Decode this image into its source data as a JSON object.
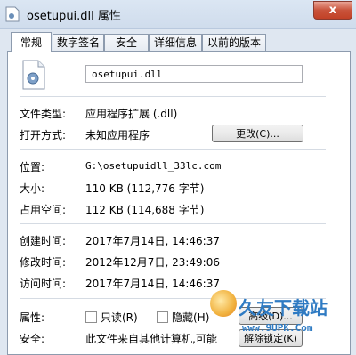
{
  "window": {
    "title": "osetupui.dll 属性",
    "close_symbol": "x"
  },
  "tabs": [
    {
      "label": "常规",
      "active": true
    },
    {
      "label": "数字签名",
      "active": false
    },
    {
      "label": "安全",
      "active": false
    },
    {
      "label": "详细信息",
      "active": false
    },
    {
      "label": "以前的版本",
      "active": false
    }
  ],
  "general": {
    "file_name": "osetupui.dll",
    "rows": {
      "type": {
        "label": "文件类型:",
        "value": "应用程序扩展 (.dll)"
      },
      "open_with": {
        "label": "打开方式:",
        "value": "未知应用程序",
        "button": "更改(C)..."
      },
      "location": {
        "label": "位置:",
        "value": "G:\\osetupuidll_33lc.com"
      },
      "size": {
        "label": "大小:",
        "value": "110 KB (112,776 字节)"
      },
      "size_on_disk": {
        "label": "占用空间:",
        "value": "112 KB (114,688 字节)"
      },
      "created": {
        "label": "创建时间:",
        "value": "2017年7月14日, 14:46:37"
      },
      "modified": {
        "label": "修改时间:",
        "value": "2012年12月7日, 23:49:06"
      },
      "accessed": {
        "label": "访问时间:",
        "value": "2017年7月14日, 14:46:37"
      }
    },
    "attributes": {
      "label": "属性:",
      "readonly": "只读(R)",
      "hidden": "隐藏(H)",
      "advanced_button": "高级(D)..."
    },
    "security": {
      "label": "安全:",
      "value": "此文件来自其他计算机,可能",
      "unblock_button": "解除锁定(K)"
    }
  },
  "watermark": {
    "text": "久友下载站",
    "url": "www.9UPK.Com"
  }
}
